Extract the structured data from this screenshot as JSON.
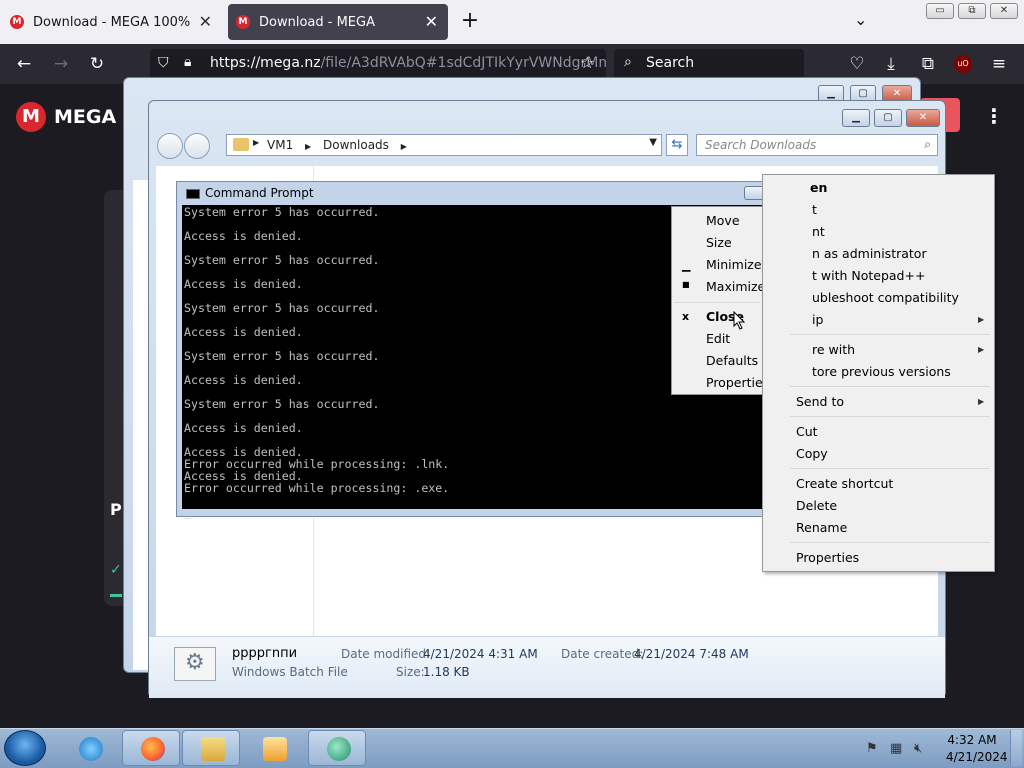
{
  "browser": {
    "tabs": [
      {
        "title": "Download - MEGA 100%",
        "active": false
      },
      {
        "title": "Download - MEGA",
        "active": true
      }
    ],
    "url_host": "https://mega.nz",
    "url_path": "/file/A3dRVAbQ#1sdCdJTIkYyrVWNdgrMm",
    "search_placeholder": "Search",
    "window_buttons": [
      "▭",
      "⧉",
      "✕"
    ]
  },
  "mega": {
    "logo_letter": "M",
    "brand": "MEGA",
    "partial_text": "P",
    "check_glyph": "✓",
    "kebab": "⋮",
    "accent": "#d9272e"
  },
  "explorer": {
    "breadcrumb": [
      "VM1",
      "Downloads"
    ],
    "search_placeholder": "Search Downloads",
    "file": {
      "name": "ppppгnпи",
      "type": "Windows Batch File",
      "date_modified_label": "Date modified:",
      "date_modified": "4/21/2024 4:31 AM",
      "date_created_label": "Date created:",
      "date_created": "4/21/2024 7:48 AM",
      "size_label": "Size:",
      "size": "1.18 KB"
    }
  },
  "cmd": {
    "title": "Command Prompt",
    "lines": [
      "System error 5 has occurred.",
      "",
      "Access is denied.",
      "",
      "System error 5 has occurred.",
      "",
      "Access is denied.",
      "",
      "System error 5 has occurred.",
      "",
      "Access is denied.",
      "",
      "System error 5 has occurred.",
      "",
      "Access is denied.",
      "",
      "System error 5 has occurred.",
      "",
      "Access is denied.",
      "",
      "Access is denied.",
      "Error occurred while processing: .lnk.",
      "Access is denied.",
      "Error occurred while processing: .exe.",
      "",
      "_"
    ]
  },
  "system_menu": {
    "items": [
      "Move",
      "Size",
      "Minimize",
      "Maximize",
      "Close",
      "Edit",
      "Defaults",
      "Properties"
    ],
    "glyphs": {
      "minimize": "▁",
      "maximize": "■",
      "close": "x"
    }
  },
  "context_menu": {
    "items": [
      "en",
      "t",
      "nt",
      "n as administrator",
      "t with Notepad++",
      "ubleshoot compatibility",
      "ip",
      "re with",
      "tore previous versions",
      "Send to",
      "Cut",
      "Copy",
      "Create shortcut",
      "Delete",
      "Rename",
      "Properties"
    ]
  },
  "taskbar": {
    "time": "4:32 AM",
    "date": "4/21/2024"
  }
}
